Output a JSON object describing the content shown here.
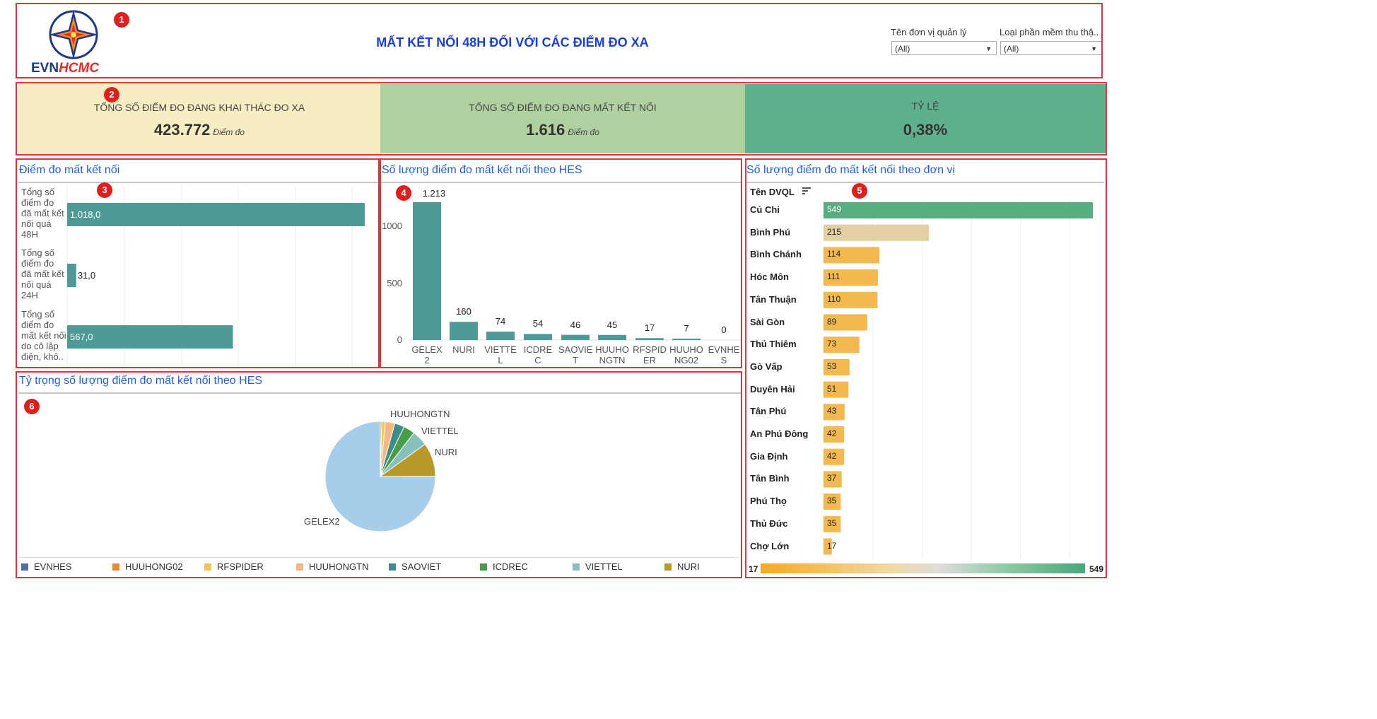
{
  "header": {
    "logo_text_1": "EVN",
    "logo_text_2": "HCMC",
    "title": "MẤT KẾT NỐI 48H ĐỐI VỚI CÁC ĐIỂM ĐO XA",
    "filters": [
      {
        "label": "Tên đơn vị quản lý",
        "value": "(All)"
      },
      {
        "label": "Loại phần mềm thu thậ..",
        "value": "(All)"
      }
    ]
  },
  "badges": [
    "1",
    "2",
    "3",
    "4",
    "5",
    "6"
  ],
  "kpis": [
    {
      "label": "TỔNG SỐ ĐIỂM ĐO ĐANG KHAI THÁC ĐO XA",
      "value": "423.772",
      "unit": "Điểm đo",
      "color": "#f6edc3"
    },
    {
      "label": "TỔNG SỐ ĐIỂM ĐO ĐANG MẤT KẾT NỐI",
      "value": "1.616",
      "unit": "Điểm đo",
      "color": "#afd19f"
    },
    {
      "label": "TỶ LỆ",
      "value": "0,38%",
      "unit": "",
      "color": "#5fb08d"
    }
  ],
  "panel3": {
    "title": "Điểm đo mất kết nối"
  },
  "panel4": {
    "title": "Số lượng điểm đo mất kết nối theo HES"
  },
  "panel5": {
    "title": "Số lượng điểm đo mất kết nối theo đơn vị",
    "sort_label": "Tên DVQL"
  },
  "panel6": {
    "title": "Tỷ trọng số lượng điểm đo mất kết nối theo HES"
  },
  "chart_data": [
    {
      "type": "bar",
      "orientation": "horizontal",
      "title": "Điểm đo mất kết nối",
      "categories": [
        "Tổng số điểm đo đã mất kết nối quá 48H",
        "Tổng số điểm đo đã mất kết nối quá 24H",
        "Tổng số điểm đo mất kết nối do cô lập điện, khô.."
      ],
      "values": [
        1018.0,
        31.0,
        567.0
      ],
      "value_labels": [
        "1.018,0",
        "31,0",
        "567,0"
      ],
      "color": "#4e9a96",
      "grid": true
    },
    {
      "type": "bar",
      "title": "Số lượng điểm đo mất kết nối theo HES",
      "categories": [
        "GELEX2",
        "NURI",
        "VIETTEL",
        "ICDREC",
        "SAOVIET",
        "HUUHONGTN",
        "RFSPIDER",
        "HUUHONG02",
        "EVNHES"
      ],
      "tick_labels": [
        [
          "GELEX",
          "2"
        ],
        [
          "NURI"
        ],
        [
          "VIETTE",
          "L"
        ],
        [
          "ICDRE",
          "C"
        ],
        [
          "SAOVIE",
          "T"
        ],
        [
          "HUUHO",
          "NGTN"
        ],
        [
          "RFSPID",
          "ER"
        ],
        [
          "HUUHO",
          "NG02"
        ],
        [
          "EVNHE",
          "S"
        ]
      ],
      "values": [
        1213,
        160,
        74,
        54,
        46,
        45,
        17,
        7,
        0
      ],
      "value_labels": [
        "1.213",
        "160",
        "74",
        "54",
        "46",
        "45",
        "17",
        "7",
        "0"
      ],
      "yticks": [
        "0",
        "500",
        "1000"
      ],
      "ylim": [
        0,
        1300
      ],
      "color": "#4e9a96"
    },
    {
      "type": "bar",
      "orientation": "horizontal",
      "title": "Số lượng điểm đo mất kết nối theo đơn vị",
      "categories": [
        "Củ Chi",
        "Bình Phú",
        "Bình Chánh",
        "Hóc Môn",
        "Tân Thuận",
        "Sài Gòn",
        "Thủ Thiêm",
        "Gò Vấp",
        "Duyên Hải",
        "Tân Phú",
        "An Phú Đông",
        "Gia Định",
        "Tân Bình",
        "Phú Thọ",
        "Thủ Đức",
        "Chợ Lớn"
      ],
      "values": [
        549,
        215,
        114,
        111,
        110,
        89,
        73,
        53,
        51,
        43,
        42,
        42,
        37,
        35,
        35,
        17
      ],
      "colors": [
        "#57ae80",
        "#e3cfa4",
        "#f3b94e",
        "#f3b94e",
        "#f3b94e",
        "#f3b94e",
        "#f3b94e",
        "#f3b94e",
        "#f3b94e",
        "#f3b94e",
        "#f3b94e",
        "#f3b94e",
        "#f3b94e",
        "#f3b94e",
        "#f3b94e",
        "#f3b94e"
      ],
      "xlim": [
        0,
        549
      ],
      "color_legend": {
        "min": "17",
        "max": "549"
      }
    },
    {
      "type": "pie",
      "title": "Tỷ trọng số lượng điểm đo mất kết nối theo HES",
      "categories": [
        "GELEX2",
        "NURI",
        "VIETTEL",
        "ICDREC",
        "SAOVIET",
        "HUUHONGTN",
        "RFSPIDER",
        "HUUHONG02",
        "EVNHES"
      ],
      "values": [
        1213,
        160,
        74,
        54,
        46,
        45,
        17,
        7,
        0
      ],
      "colors": [
        "#a6cde9",
        "#b89a2b",
        "#86bfbc",
        "#499d4a",
        "#3d8e8b",
        "#f6b880",
        "#efc65c",
        "#e98c2d",
        "#4f6fa6"
      ],
      "slice_labels": [
        "GELEX2",
        "NURI",
        "VIETTEL",
        "HUUHONGTN"
      ],
      "legend": [
        "EVNHES",
        "HUUHONG02",
        "RFSPIDER",
        "HUUHONGTN",
        "SAOVIET",
        "ICDREC",
        "VIETTEL",
        "NURI"
      ],
      "legend_colors": [
        "#4f6fa6",
        "#e98c2d",
        "#efc65c",
        "#f6b880",
        "#3d8e8b",
        "#499d4a",
        "#86bfbc",
        "#b89a2b"
      ],
      "legend_position": "bottom"
    }
  ]
}
